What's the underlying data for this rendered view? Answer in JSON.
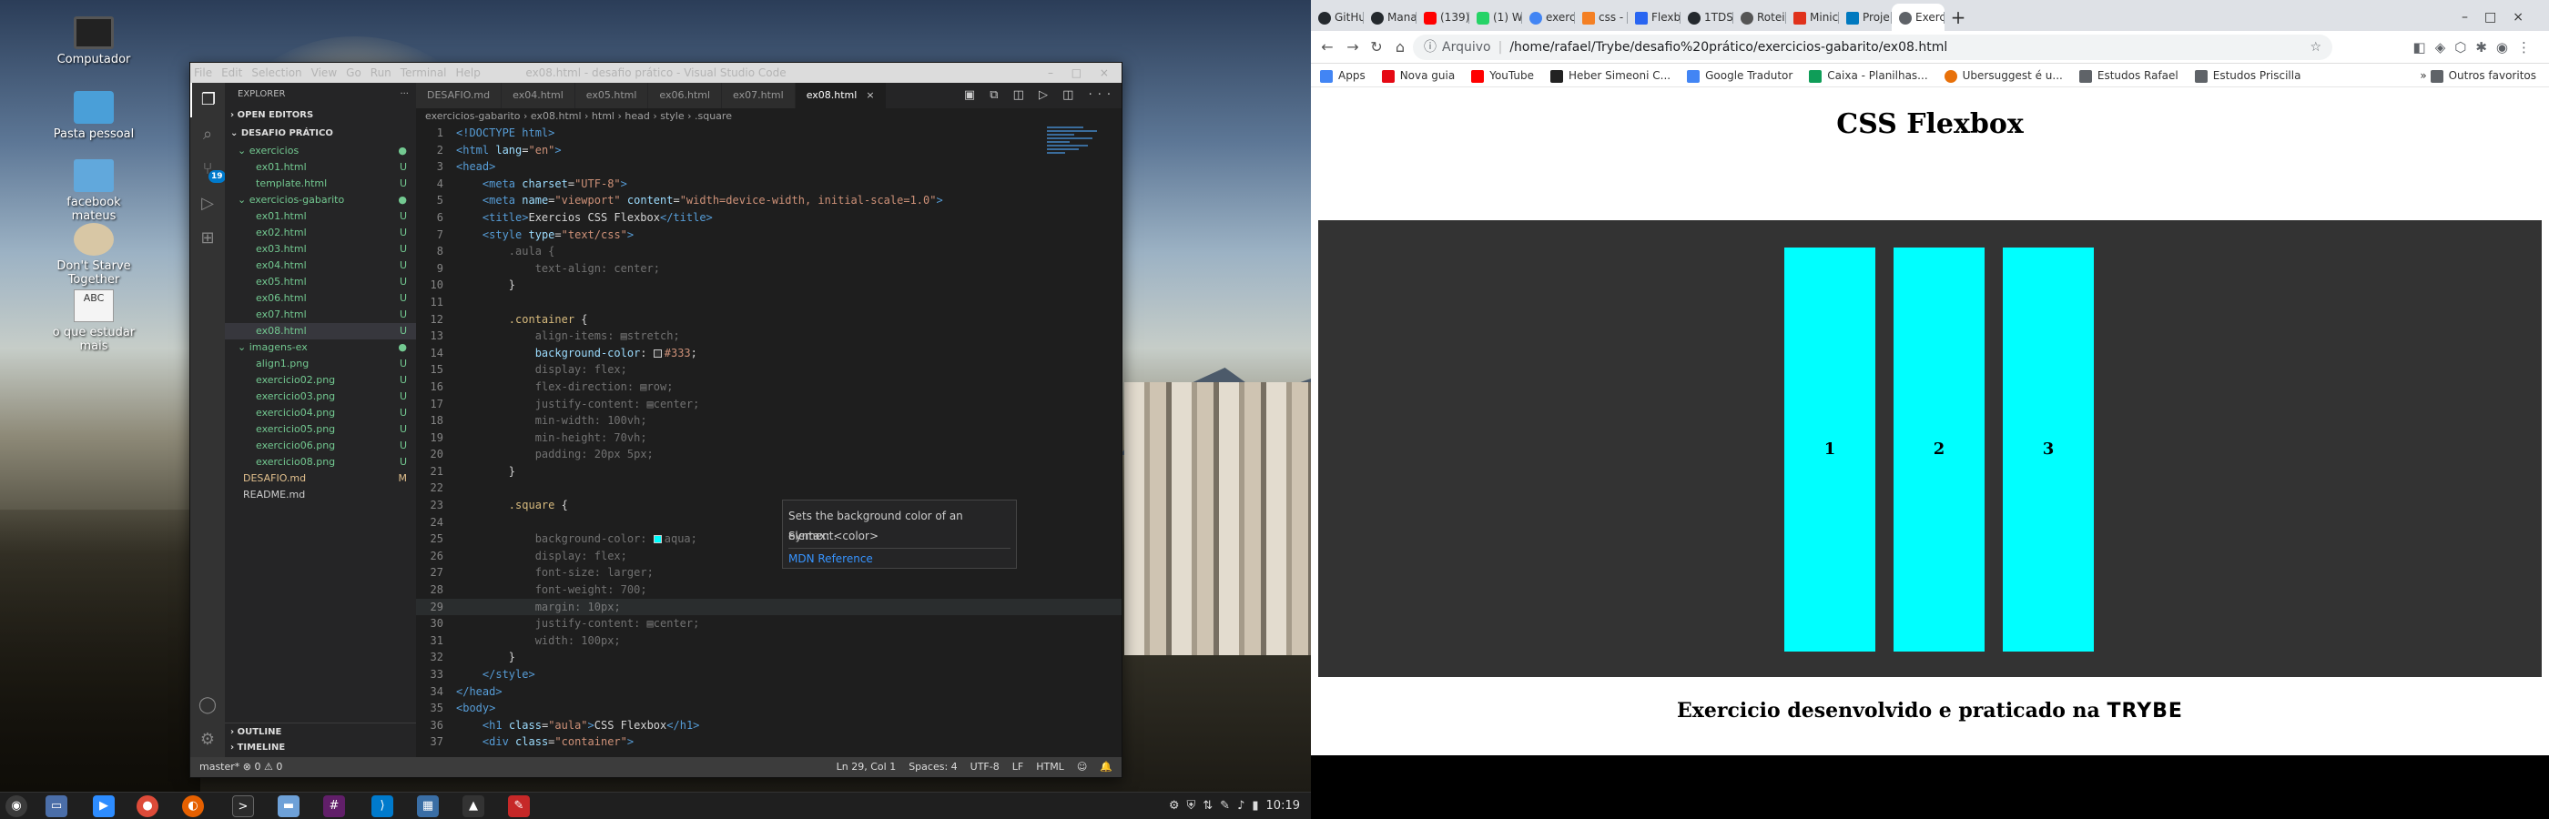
{
  "desktop": {
    "icons": [
      {
        "label": "Computador",
        "icon": "computer-icon"
      },
      {
        "label": "Pasta pessoal",
        "icon": "home-folder-icon"
      },
      {
        "label": "facebook mateus",
        "icon": "folder-icon"
      },
      {
        "label": "Don't Starve Together",
        "icon": "game-icon"
      },
      {
        "label": "o que estudar mais",
        "icon": "text-document-icon",
        "glyph": "ABC"
      }
    ]
  },
  "vscode": {
    "title": "ex08.html - desafio prático - Visual Studio Code",
    "window_controls": "– □ ×",
    "menu": [
      "File",
      "Edit",
      "Selection",
      "View",
      "Go",
      "Run",
      "Terminal",
      "Help"
    ],
    "explorer": {
      "header": "EXPLORER",
      "more": "···",
      "open_editors": "OPEN EDITORS",
      "root": "DESAFIO PRÁTICO",
      "folders": [
        {
          "name": "exercicios",
          "files": [
            {
              "name": "ex01.html",
              "badge": "U"
            },
            {
              "name": "template.html",
              "badge": "U"
            }
          ]
        },
        {
          "name": "exercicios-gabarito",
          "files": [
            {
              "name": "ex01.html",
              "badge": "U"
            },
            {
              "name": "ex02.html",
              "badge": "U"
            },
            {
              "name": "ex03.html",
              "badge": "U"
            },
            {
              "name": "ex04.html",
              "badge": "U"
            },
            {
              "name": "ex05.html",
              "badge": "U"
            },
            {
              "name": "ex06.html",
              "badge": "U"
            },
            {
              "name": "ex07.html",
              "badge": "U"
            },
            {
              "name": "ex08.html",
              "badge": "U"
            }
          ]
        },
        {
          "name": "imagens-ex",
          "files": [
            {
              "name": "align1.png",
              "badge": "U"
            },
            {
              "name": "exercicio02.png",
              "badge": "U"
            },
            {
              "name": "exercicio03.png",
              "badge": "U"
            },
            {
              "name": "exercicio04.png",
              "badge": "U"
            },
            {
              "name": "exercicio05.png",
              "badge": "U"
            },
            {
              "name": "exercicio06.png",
              "badge": "U"
            },
            {
              "name": "exercicio08.png",
              "badge": "U"
            }
          ]
        }
      ],
      "root_files": [
        {
          "name": "DESAFIO.md",
          "badge": "M"
        },
        {
          "name": "README.md",
          "badge": ""
        }
      ],
      "outline": "OUTLINE",
      "timeline": "TIMELINE"
    },
    "tabs": [
      {
        "label": "DESAFIO.md",
        "active": false
      },
      {
        "label": "ex04.html",
        "active": false
      },
      {
        "label": "ex05.html",
        "active": false
      },
      {
        "label": "ex06.html",
        "active": false
      },
      {
        "label": "ex07.html",
        "active": false
      },
      {
        "label": "ex08.html",
        "active": true
      }
    ],
    "tab_close": "×",
    "breadcrumb": "exercicios-gabarito › ex08.html › html › head › style › .square",
    "hover": {
      "description": "Sets the background color of an element.",
      "syntax": "Syntax: <color>",
      "link": "MDN Reference"
    },
    "statusbar": {
      "branch": "master*",
      "problems": "⊗ 0 ⚠ 0",
      "position": "Ln 29, Col 1",
      "spaces": "Spaces: 4",
      "encoding": "UTF-8",
      "eol": "LF",
      "language": "HTML"
    },
    "activity_icons": [
      "files-icon",
      "search-icon",
      "source-control-icon",
      "run-debug-icon",
      "extensions-icon"
    ],
    "scm_badge": "19"
  },
  "browser": {
    "tabs": [
      {
        "label": "GitHub",
        "color": "#24292e"
      },
      {
        "label": "Mana",
        "color": "#24292e"
      },
      {
        "label": "(139)",
        "color": "#ff0000"
      },
      {
        "label": "(1) W",
        "color": "#25d366"
      },
      {
        "label": "exerc",
        "color": "#4285f4"
      },
      {
        "label": "css -",
        "color": "#f48024"
      },
      {
        "label": "Flexb",
        "color": "#2965f1"
      },
      {
        "label": "1TDS",
        "color": "#24292e"
      },
      {
        "label": "Roteir",
        "color": "#555555"
      },
      {
        "label": "Minic",
        "color": "#e0321c"
      },
      {
        "label": "Proje",
        "color": "#0079bf"
      },
      {
        "label": "Exerc",
        "color": "#5f6368",
        "active": true
      }
    ],
    "new_tab": "+",
    "url_prefix": "Arquivo",
    "url": "/home/rafael/Trybe/desafio%20prático/exercicios-gabarito/ex08.html",
    "bookmarks": [
      {
        "label": "Apps",
        "color": "#4285f4"
      },
      {
        "label": "Nova guia",
        "color": "#e50914"
      },
      {
        "label": "YouTube",
        "color": "#ff0000"
      },
      {
        "label": "Heber Simeoni C...",
        "color": "#222222"
      },
      {
        "label": "Google Tradutor",
        "color": "#4285f4"
      },
      {
        "label": "Caixa - Planilhas...",
        "color": "#0f9d58"
      },
      {
        "label": "Ubersuggest é u...",
        "color": "#e8710a"
      },
      {
        "label": "Estudos Rafael",
        "color": "#5f6368"
      },
      {
        "label": "Estudos Priscilla",
        "color": "#5f6368"
      }
    ],
    "bookmarks_more": "»",
    "other_bookmarks": "Outros favoritos",
    "page": {
      "heading": "CSS Flexbox",
      "squares": [
        "1",
        "2",
        "3"
      ],
      "footer_text": "Exercicio desenvolvido e praticado na",
      "footer_brand": "TRYBE",
      "container_bg": "#333333",
      "square_bg": "#00ffff"
    }
  },
  "taskbar": {
    "clock": "10:19"
  }
}
